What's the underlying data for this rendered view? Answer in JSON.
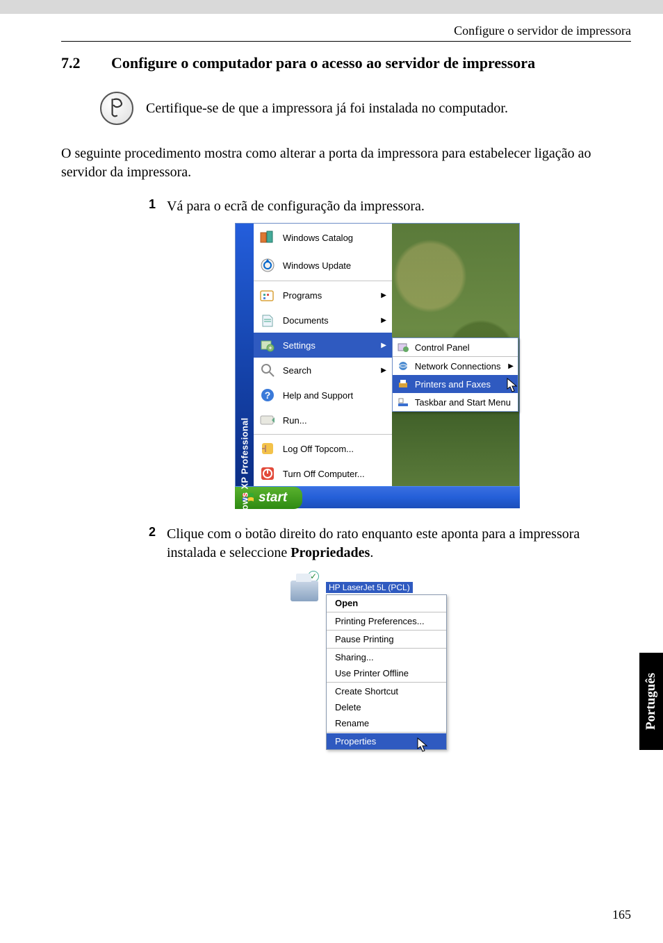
{
  "header": {
    "breadcrumb": "Configure o servidor de impressora"
  },
  "section": {
    "number": "7.2",
    "title": "Configure o computador para o acesso ao servidor de impressora"
  },
  "note": {
    "text": "Certifique-se de que a impressora já foi instalada no computador."
  },
  "intro": "O seguinte procedimento mostra como alterar a porta da impressora para estabelecer ligação ao servidor da impressora.",
  "steps": [
    {
      "num": "1",
      "text": "Vá para o ecrã de configuração da impressora."
    },
    {
      "num": "2",
      "text_prefix": "Clique com o botão direito do rato enquanto este aponta para a impressora instalada e seleccione ",
      "bold": "Propriedades",
      "text_suffix": "."
    }
  ],
  "screenshot1": {
    "os_label": "Windows XP Professional",
    "menu": {
      "top": [
        {
          "label": "Windows Catalog",
          "icon": "catalog"
        },
        {
          "label": "Windows Update",
          "icon": "update"
        }
      ],
      "main": [
        {
          "label": "Programs",
          "icon": "programs",
          "submenu": true
        },
        {
          "label": "Documents",
          "icon": "documents",
          "submenu": true
        },
        {
          "label": "Settings",
          "icon": "settings",
          "submenu": true,
          "hover": true
        },
        {
          "label": "Search",
          "icon": "search",
          "submenu": true
        },
        {
          "label": "Help and Support",
          "icon": "help"
        },
        {
          "label": "Run...",
          "icon": "run"
        }
      ],
      "bottom": [
        {
          "label": "Log Off Topcom...",
          "icon": "logoff"
        },
        {
          "label": "Turn Off Computer...",
          "icon": "turnoff"
        }
      ]
    },
    "submenu": [
      {
        "label": "Control Panel",
        "icon": "control-panel"
      },
      {
        "label": "Network Connections",
        "icon": "network",
        "submenu": true
      },
      {
        "label": "Printers and Faxes",
        "icon": "printers",
        "hover": true
      },
      {
        "label": "Taskbar and Start Menu",
        "icon": "taskbar"
      }
    ],
    "start_button": "start"
  },
  "screenshot2": {
    "printer_name": "HP LaserJet 5L (PCL)",
    "context_menu": [
      {
        "label": "Open",
        "bold": true
      },
      {
        "sep": true
      },
      {
        "label": "Printing Preferences..."
      },
      {
        "sep": true
      },
      {
        "label": "Pause Printing"
      },
      {
        "sep": true
      },
      {
        "label": "Sharing..."
      },
      {
        "label": "Use Printer Offline"
      },
      {
        "sep": true
      },
      {
        "label": "Create Shortcut"
      },
      {
        "label": "Delete"
      },
      {
        "label": "Rename"
      },
      {
        "sep": true
      },
      {
        "label": "Properties",
        "hover": true
      }
    ]
  },
  "side_tab": "Português",
  "page_number": "165"
}
